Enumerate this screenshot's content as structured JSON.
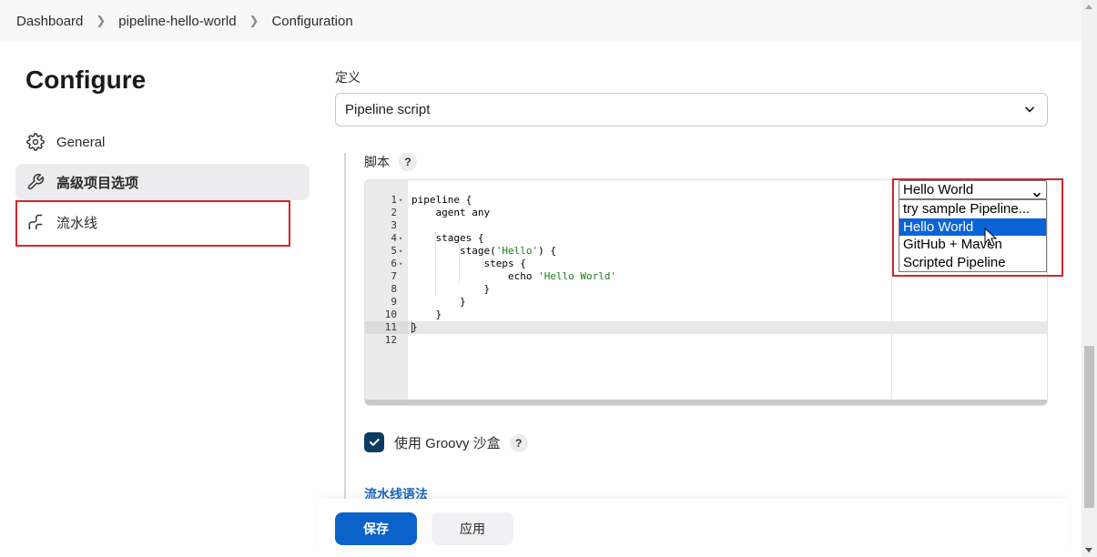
{
  "breadcrumb": {
    "items": [
      "Dashboard",
      "pipeline-hello-world",
      "Configuration"
    ]
  },
  "sidebar": {
    "title": "Configure",
    "items": [
      {
        "label": "General",
        "icon": "gear-icon"
      },
      {
        "label": "高级项目选项",
        "icon": "wrench-icon"
      },
      {
        "label": "流水线",
        "icon": "pipeline-icon"
      }
    ]
  },
  "definition": {
    "label": "定义",
    "value": "Pipeline script"
  },
  "script": {
    "label": "脚本",
    "help": "?",
    "lines": [
      {
        "n": "1",
        "fold": "▾",
        "text": "pipeline {"
      },
      {
        "n": "2",
        "fold": "",
        "text": "    agent any"
      },
      {
        "n": "3",
        "fold": "",
        "text": ""
      },
      {
        "n": "4",
        "fold": "▾",
        "text": "    stages {"
      },
      {
        "n": "5",
        "fold": "▾",
        "pre": "        stage(",
        "str": "'Hello'",
        "post": ") {"
      },
      {
        "n": "6",
        "fold": "▾",
        "text": "            steps {"
      },
      {
        "n": "7",
        "fold": "",
        "pre": "                echo ",
        "str": "'Hello World'",
        "post": ""
      },
      {
        "n": "8",
        "fold": "",
        "text": "            }"
      },
      {
        "n": "9",
        "fold": "",
        "text": "        }"
      },
      {
        "n": "10",
        "fold": "",
        "text": "    }"
      },
      {
        "n": "11",
        "fold": "",
        "text": "}"
      },
      {
        "n": "12",
        "fold": "",
        "text": ""
      }
    ]
  },
  "sample": {
    "selected": "Hello World",
    "options": [
      "try sample Pipeline...",
      "Hello World",
      "GitHub + Maven",
      "Scripted Pipeline"
    ]
  },
  "sandbox": {
    "label": "使用 Groovy 沙盒",
    "checked": true,
    "help": "?"
  },
  "pipeline_syntax_link": "流水线语法",
  "buttons": {
    "save": "保存",
    "apply": "应用"
  },
  "colors": {
    "accent": "#0b63c9",
    "highlight": "#d3262b",
    "checkbox": "#0d3c61"
  }
}
